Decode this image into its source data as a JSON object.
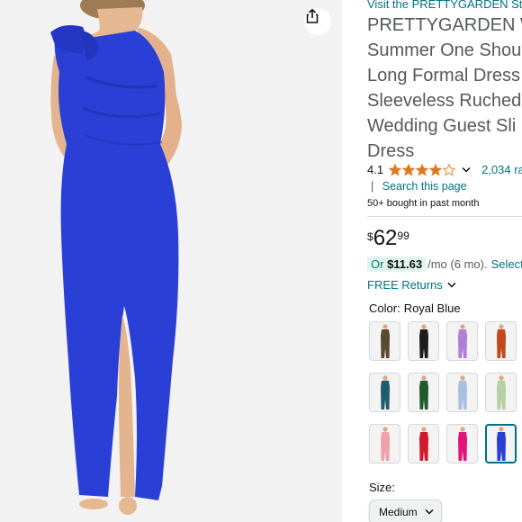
{
  "product": {
    "store_link": "Visit the PRETTYGARDEN Store",
    "title_lines": [
      "PRETTYGARDEN W",
      "Summer One Shou",
      "Long Formal Dress",
      "Sleeveless Ruched",
      "Wedding Guest Sli",
      "Dress"
    ],
    "rating": {
      "value": "4.1",
      "stars": 4.1,
      "count_text": "2,034 ra",
      "caret_icon": "chevron-down-icon"
    },
    "search_link": "Search this page",
    "bought_text": "50+ bought in past month",
    "price": {
      "symbol": "$",
      "whole": "62",
      "fraction": "99"
    },
    "monthly": {
      "prefix": "Or ",
      "amount": "$11.63",
      "term": "/mo (6 mo).",
      "select_text": "Select f"
    },
    "returns": "FREE Returns",
    "color": {
      "label": "Color:",
      "selected": "Royal Blue",
      "swatches": [
        {
          "name": "olive",
          "hex": "#5a4a2e"
        },
        {
          "name": "black",
          "hex": "#1c1c1c"
        },
        {
          "name": "lavender",
          "hex": "#b07fd6"
        },
        {
          "name": "rust",
          "hex": "#c2481e"
        },
        {
          "name": "teal",
          "hex": "#1f5c6e"
        },
        {
          "name": "dark green",
          "hex": "#1f5a2c"
        },
        {
          "name": "light blue",
          "hex": "#a9bfe0"
        },
        {
          "name": "sage",
          "hex": "#b6cfa4"
        },
        {
          "name": "pink",
          "hex": "#f0a0a8"
        },
        {
          "name": "red",
          "hex": "#d11b2a"
        },
        {
          "name": "hot pink",
          "hex": "#e0147a"
        },
        {
          "name": "royal blue",
          "hex": "#2a3fd6"
        }
      ],
      "selected_index": 11
    },
    "size": {
      "label": "Size:",
      "selected": "Medium"
    }
  },
  "icons": {
    "share": "share-icon",
    "star": "star-icon",
    "chevron": "chevron-down-icon"
  },
  "colors": {
    "link": "#007185",
    "star": "#de7921",
    "dress": "#2a3fd6",
    "badge_bg": "#dff5ed"
  }
}
